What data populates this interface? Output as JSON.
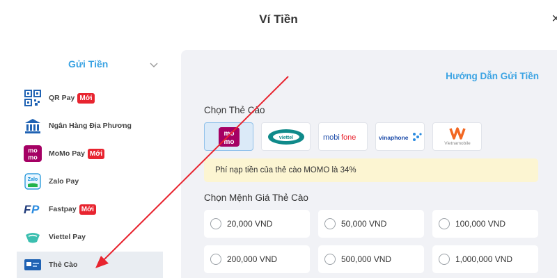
{
  "modal": {
    "title": "Ví Tiền",
    "close_glyph": "×"
  },
  "sidebar": {
    "title": "Gửi Tiền",
    "items": [
      {
        "label": "QR Pay",
        "icon": "qr-code-icon",
        "badge": "Mới"
      },
      {
        "label": "Ngân Hàng Địa Phương",
        "icon": "bank-icon",
        "badge": ""
      },
      {
        "label": "MoMo Pay",
        "icon": "momo-icon",
        "badge": "Mới"
      },
      {
        "label": "Zalo Pay",
        "icon": "zalopay-icon",
        "badge": ""
      },
      {
        "label": "Fastpay",
        "icon": "fastpay-icon",
        "badge": "Mới"
      },
      {
        "label": "Viettel Pay",
        "icon": "viettelpay-icon",
        "badge": ""
      },
      {
        "label": "Thẻ Cào",
        "icon": "card-icon",
        "badge": "",
        "active": true
      }
    ]
  },
  "main": {
    "guide_link": "Hướng Dẫn Gửi Tiền",
    "card_section_label": "Chọn Thẻ Cào",
    "carriers": [
      {
        "name": "momo",
        "logo_text": "mo mo",
        "selected": true
      },
      {
        "name": "viettel",
        "logo_text": "viettel",
        "selected": false
      },
      {
        "name": "mobifone",
        "logo_text": "mobifone",
        "selected": false
      },
      {
        "name": "vinaphone",
        "logo_text": "vinaphone",
        "selected": false
      },
      {
        "name": "vietnamobile",
        "logo_text": "Vietnamobile",
        "selected": false
      }
    ],
    "notice": "Phí nạp tiền của thẻ cào MOMO là 34%",
    "denomination_label": "Chọn Mệnh Giá Thẻ Cào",
    "amounts": [
      "20,000 VND",
      "50,000 VND",
      "100,000 VND",
      "200,000 VND",
      "500,000 VND",
      "1,000,000 VND"
    ]
  },
  "colors": {
    "accent": "#3aa3e3",
    "badge": "#e8242f",
    "arrow": "#e8242f",
    "momo": "#a50064",
    "notice_bg": "#fcf5d2"
  }
}
